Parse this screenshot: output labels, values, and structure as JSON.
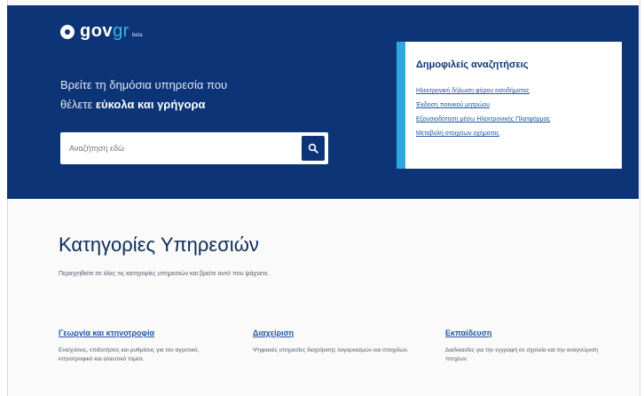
{
  "colors": {
    "primary": "#0d3476",
    "accent": "#2fa8e0",
    "link": "#1f57a3"
  },
  "logo": {
    "main": "gov",
    "accent": "gr",
    "suffix": "beta"
  },
  "hero": {
    "line1": "Βρείτε τη δημόσια υπηρεσία που",
    "line2_prefix": "θέλετε ",
    "line2_emphasis": "εύκολα και γρήγορα"
  },
  "search": {
    "placeholder": "Αναζήτηση εδώ",
    "button_icon": "search-icon"
  },
  "popular": {
    "title": "Δημοφιλείς αναζητήσεις",
    "links": [
      "Ηλεκτρονική δήλωση φόρου εισοδήματος",
      "Έκδοση ποινικού μητρώου",
      "Εξουσιοδότηση μέσω Ηλεκτρονικής Πλατφόρμας",
      "Μεταβολή στοιχείων οχήματος"
    ]
  },
  "categories": {
    "title": "Κατηγορίες Υπηρεσιών",
    "subtitle": "Περιηγηθείτε σε όλες τις κατηγορίες υπηρεσιών και βρείτε αυτό που ψάχνετε.",
    "items": [
      {
        "title": "Γεωργία και κτηνοτροφία",
        "desc": "Ενισχύσεις, επιδοτήσεις και ρυθμίσεις για τον αγροτικό, κτηνοτροφικό και αλιευτικό τομέα."
      },
      {
        "title": "Διαχείριση",
        "desc": "Ψηφιακές υπηρεσίες διαχείρισης λογαριασμών και στοιχείων."
      },
      {
        "title": "Εκπαίδευση",
        "desc": "Διαδικασίες για την εγγραφή σε σχολεία και την αναγνώριση πτυχίων."
      }
    ]
  }
}
